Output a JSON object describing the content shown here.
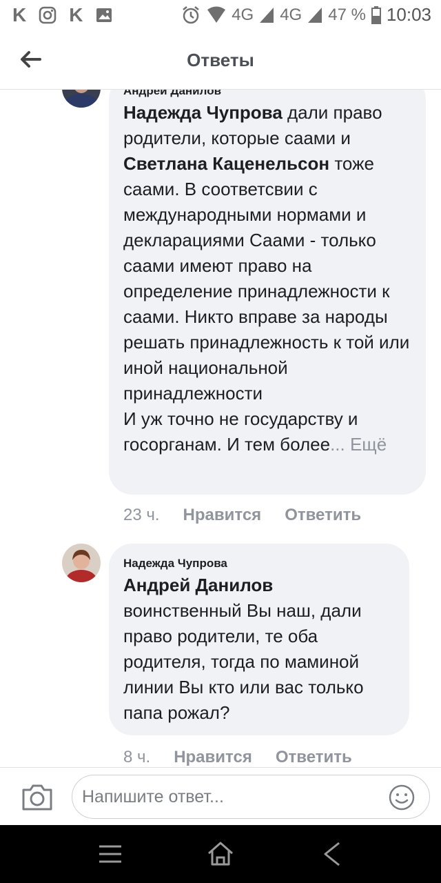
{
  "status_bar": {
    "network_1": "4G",
    "network_2": "4G",
    "battery": "47 %",
    "time": "10:03"
  },
  "header": {
    "title": "Ответы",
    "back_icon": "arrow-left-icon"
  },
  "comments": [
    {
      "author": "Андрей Данилов",
      "segments": [
        {
          "text": "Надежда Чупрова",
          "mention": true
        },
        {
          "text": " дали право родители, которые саами и ",
          "mention": false
        },
        {
          "text": "Светлана Каценельсон",
          "mention": true
        },
        {
          "text": " тоже саами. В соответсвии с международными нормами и декларациями Саами - только саами имеют право на определение принадлежности к саами. Никто вправе за народы решать принадлежность к той или иной национальной принадлежности",
          "mention": false
        },
        {
          "text": "И уж точно не государству и госорганам. И тем более",
          "mention": false
        }
      ],
      "ellipsis": "...",
      "more_label": "Ещё",
      "time": "23 ч.",
      "like_label": "Нравится",
      "reply_label": "Ответить"
    },
    {
      "author": "Надежда Чупрова",
      "segments": [
        {
          "text": "Андрей Данилов",
          "mention": true
        },
        {
          "text": "воинственный Вы наш, дали право родители, те оба родителя, тогда по маминой линии Вы кто или вас только папа рожал?",
          "mention": false
        }
      ],
      "time": "8 ч.",
      "like_label": "Нравится",
      "reply_label": "Ответить"
    }
  ],
  "composer": {
    "placeholder": "Напишите ответ...",
    "camera_icon": "camera-icon",
    "emoji_icon": "smiley-icon"
  },
  "nav_bar": {
    "menu_icon": "menu-icon",
    "home_icon": "home-icon",
    "back_icon": "back-triangle-icon"
  },
  "colors": {
    "bubble": "#f0f2f5",
    "secondary_text": "#90949c",
    "title_text": "#4b4f56"
  }
}
